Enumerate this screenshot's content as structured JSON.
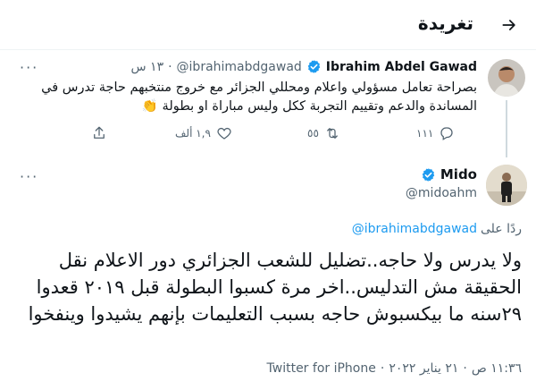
{
  "header": {
    "title": "تغريدة"
  },
  "original_tweet": {
    "author_name": "Ibrahim Abdel Gawad",
    "author_handle": "@ibrahimabdgawad",
    "time": "١٣ س",
    "text": "بصراحة تعامل مسؤولي واعلام ومحللي الجزائر مع خروج منتخبهم حاجة تدرس في المساندة والدعم وتقييم التجربة ككل وليس مباراة او بطولة 👏",
    "actions": {
      "replies": "١١١",
      "retweets": "٥٥",
      "likes": "١,٩ ألف"
    }
  },
  "reply_tweet": {
    "author_name": "Mido",
    "author_handle": "@midoahm",
    "reply_label": "ردًا على",
    "reply_mention": "@ibrahimabdgawad",
    "text": "ولا يدرس ولا حاجه..تضليل للشعب الجزائري دور الاعلام نقل الحقيقة مش التدليس..اخر مرة كسبوا البطولة قبل ٢٠١٩ قعدوا ٢٩سنه ما بيكسبوش حاجه بسبب التعليمات بإنهم يشيدوا وينفخوا",
    "time": "١١:٣٦ ص",
    "date": "٢١ يناير ٢٠٢٢",
    "source": "Twitter for iPhone"
  },
  "colors": {
    "verified": "#1d9bf0",
    "link": "#1d9bf0",
    "muted": "#536471"
  }
}
